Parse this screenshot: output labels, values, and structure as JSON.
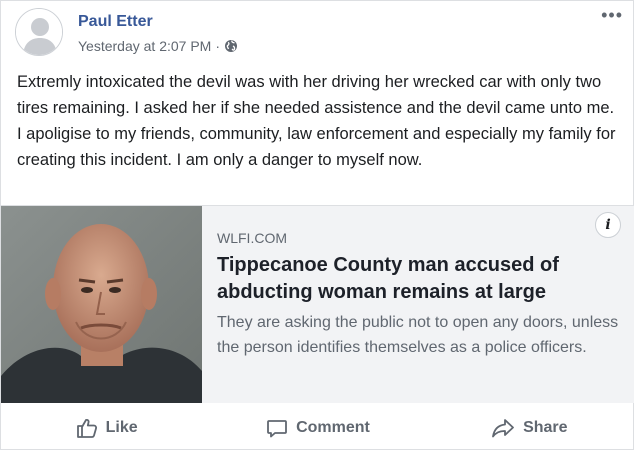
{
  "post": {
    "author": "Paul Etter",
    "timestamp": "Yesterday at 2:07 PM",
    "separator": "·",
    "privacy_icon": "globe-icon",
    "more_icon": "more-options-icon",
    "text": "Extremly intoxicated the devil was with her driving her wrecked car with only two tires remaining. I asked her if she needed assistence and the devil came unto me. I apoligise to my friends, community, law enforcement and especially my family for creating this incident. I am only a danger to myself now."
  },
  "link_card": {
    "domain": "WLFI.COM",
    "headline": "Tippecanoe County man accused of abducting woman remains at large",
    "description": "They are asking the public not to open any doors, unless the person identifies themselves as a police officers.",
    "info_label": "i"
  },
  "actions": {
    "like": "Like",
    "comment": "Comment",
    "share": "Share"
  },
  "colors": {
    "author": "#385898",
    "secondary_text": "#606770",
    "card_background": "#f2f3f5"
  }
}
